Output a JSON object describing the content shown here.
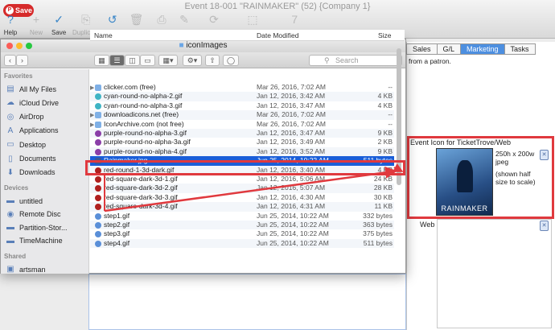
{
  "app": {
    "window_title": "Event 18-001 \"RAINMAKER\" (52) {Company 1}",
    "save_badge": "Save",
    "toolbar": [
      {
        "label": "Help",
        "icon": "help-icon",
        "enabled": true
      },
      {
        "label": "New",
        "icon": "new-icon",
        "enabled": false
      },
      {
        "label": "Save",
        "icon": "save-icon",
        "enabled": true
      },
      {
        "label": "Duplicate",
        "icon": "duplicate-icon",
        "enabled": false
      },
      {
        "label": "Revert",
        "icon": "revert-icon",
        "enabled": true
      },
      {
        "label": "Delete",
        "icon": "delete-icon",
        "enabled": false
      },
      {
        "label": "Print",
        "icon": "print-icon",
        "enabled": false
      },
      {
        "label": "Spell",
        "icon": "spell-icon",
        "enabled": false
      },
      {
        "label": "Refresh",
        "icon": "refresh-icon",
        "enabled": false
      },
      {
        "label": "Hide Seat Status",
        "icon": "seat-status-icon",
        "enabled": false
      },
      {
        "label": "Calendar",
        "icon": "calendar-icon",
        "enabled": false
      }
    ]
  },
  "tabs": [
    "Sales",
    "G/L",
    "Marketing",
    "Tasks"
  ],
  "active_tab": "Marketing",
  "marketing": {
    "patron_text": "from a patron.",
    "icon_section_label": "Event Icon for TicketTrove/Web",
    "icon_image_text": "RAINMAKER",
    "icon_dimensions": "250h x 200w jpeg",
    "icon_note": "(shown half size to scale)",
    "web_label": "Web"
  },
  "finder": {
    "title": "iconImages",
    "search_placeholder": "Search",
    "columns": {
      "name": "Name",
      "date": "Date Modified",
      "size": "Size"
    },
    "sidebar": {
      "favorites_header": "Favorites",
      "favorites": [
        {
          "label": "All My Files",
          "icon": "all-files-icon"
        },
        {
          "label": "iCloud Drive",
          "icon": "icloud-icon"
        },
        {
          "label": "AirDrop",
          "icon": "airdrop-icon"
        },
        {
          "label": "Applications",
          "icon": "applications-icon"
        },
        {
          "label": "Desktop",
          "icon": "desktop-icon"
        },
        {
          "label": "Documents",
          "icon": "documents-icon"
        },
        {
          "label": "Downloads",
          "icon": "downloads-icon"
        }
      ],
      "devices_header": "Devices",
      "devices": [
        {
          "label": "untitled",
          "icon": "drive-icon"
        },
        {
          "label": "Remote Disc",
          "icon": "disc-icon"
        },
        {
          "label": "Partition-Stor...",
          "icon": "drive-icon"
        },
        {
          "label": "TimeMachine",
          "icon": "drive-icon"
        }
      ],
      "shared_header": "Shared",
      "shared": [
        {
          "label": "artsman",
          "icon": "network-icon"
        }
      ]
    },
    "files": [
      {
        "name": "clicker.com (free)",
        "date": "Mar 26, 2016, 7:02 AM",
        "size": "--",
        "kind": "folder"
      },
      {
        "name": "cyan-round-no-alpha-2.gif",
        "date": "Jan 12, 2016, 3:42 AM",
        "size": "4 KB",
        "kind": "cyan"
      },
      {
        "name": "cyan-round-no-alpha-3.gif",
        "date": "Jan 12, 2016, 3:47 AM",
        "size": "4 KB",
        "kind": "cyan"
      },
      {
        "name": "downloadicons.net (free)",
        "date": "Mar 26, 2016, 7:02 AM",
        "size": "--",
        "kind": "folder"
      },
      {
        "name": "IconArchive.com (not free)",
        "date": "Mar 26, 2016, 7:02 AM",
        "size": "--",
        "kind": "folder"
      },
      {
        "name": "purple-round-no-alpha-3.gif",
        "date": "Jan 12, 2016, 3:47 AM",
        "size": "9 KB",
        "kind": "purple"
      },
      {
        "name": "purple-round-no-alpha-3a.gif",
        "date": "Jan 12, 2016, 3:49 AM",
        "size": "2 KB",
        "kind": "purple"
      },
      {
        "name": "purple-round-no-alpha-4.gif",
        "date": "Jan 12, 2016, 3:52 AM",
        "size": "9 KB",
        "kind": "purple"
      },
      {
        "name": "Rainmaker.jpg",
        "date": "Jun 25, 2014, 10:22 AM",
        "size": "511 bytes",
        "kind": "jpg",
        "selected": true
      },
      {
        "name": "red-round-1-3d-dark.gif",
        "date": "Jan 12, 2016, 3:40 AM",
        "size": "4 KB",
        "kind": "red"
      },
      {
        "name": "red-square-dark-3d-1.gif",
        "date": "Jan 12, 2016, 5:06 AM",
        "size": "24 KB",
        "kind": "red"
      },
      {
        "name": "red-square-dark-3d-2.gif",
        "date": "Jan 12, 2016, 5:07 AM",
        "size": "28 KB",
        "kind": "red"
      },
      {
        "name": "red-square-dark-3d-3.gif",
        "date": "Jan 12, 2016, 4:30 AM",
        "size": "30 KB",
        "kind": "red"
      },
      {
        "name": "red-square-dark-3d-4.gif",
        "date": "Jan 12, 2016, 4:31 AM",
        "size": "11 KB",
        "kind": "red"
      },
      {
        "name": "step1.gif",
        "date": "Jun 25, 2014, 10:22 AM",
        "size": "332 bytes",
        "kind": "step"
      },
      {
        "name": "step2.gif",
        "date": "Jun 25, 2014, 10:22 AM",
        "size": "363 bytes",
        "kind": "step"
      },
      {
        "name": "step3.gif",
        "date": "Jun 25, 2014, 10:22 AM",
        "size": "375 bytes",
        "kind": "step"
      },
      {
        "name": "step4.gif",
        "date": "Jun 25, 2014, 10:22 AM",
        "size": "511 bytes",
        "kind": "step"
      }
    ]
  },
  "colors": {
    "selection": "#1a5ed8",
    "highlight_red": "#e0393e",
    "active_tab": "#4d8fe0"
  }
}
